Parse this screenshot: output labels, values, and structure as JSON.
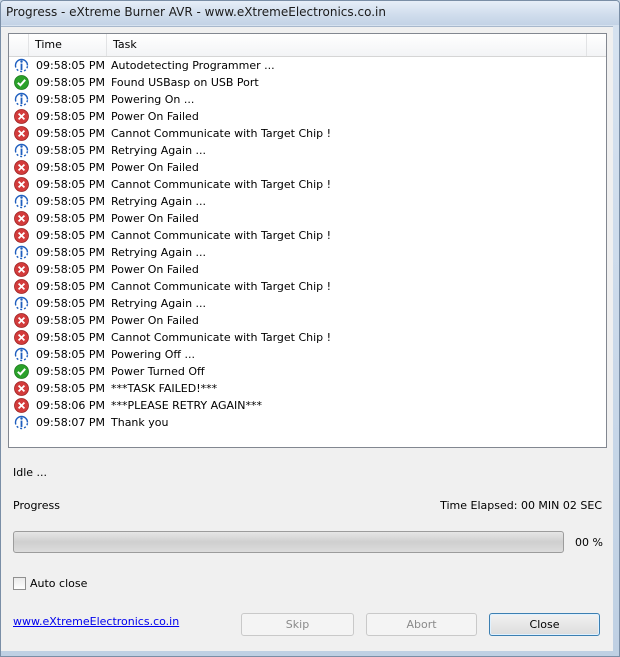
{
  "window": {
    "title": "Progress - eXtreme Burner AVR - www.eXtremeElectronics.co.in"
  },
  "colors": {
    "info": "#1f5fbf",
    "success": "#2aa12a",
    "error": "#d33b3b",
    "progress_fill": "#06b025"
  },
  "log": {
    "columns": {
      "time": "Time",
      "task": "Task"
    },
    "rows": [
      {
        "icon": "info-icon",
        "time": "09:58:05 PM",
        "task": "Autodetecting Programmer ..."
      },
      {
        "icon": "success-icon",
        "time": "09:58:05 PM",
        "task": "Found USBasp on USB Port"
      },
      {
        "icon": "info-icon",
        "time": "09:58:05 PM",
        "task": "Powering On ..."
      },
      {
        "icon": "error-icon",
        "time": "09:58:05 PM",
        "task": "Power On Failed"
      },
      {
        "icon": "error-icon",
        "time": "09:58:05 PM",
        "task": "Cannot Communicate with Target Chip !"
      },
      {
        "icon": "info-icon",
        "time": "09:58:05 PM",
        "task": "Retrying Again ..."
      },
      {
        "icon": "error-icon",
        "time": "09:58:05 PM",
        "task": "Power On Failed"
      },
      {
        "icon": "error-icon",
        "time": "09:58:05 PM",
        "task": "Cannot Communicate with Target Chip !"
      },
      {
        "icon": "info-icon",
        "time": "09:58:05 PM",
        "task": "Retrying Again ..."
      },
      {
        "icon": "error-icon",
        "time": "09:58:05 PM",
        "task": "Power On Failed"
      },
      {
        "icon": "error-icon",
        "time": "09:58:05 PM",
        "task": "Cannot Communicate with Target Chip !"
      },
      {
        "icon": "info-icon",
        "time": "09:58:05 PM",
        "task": "Retrying Again ..."
      },
      {
        "icon": "error-icon",
        "time": "09:58:05 PM",
        "task": "Power On Failed"
      },
      {
        "icon": "error-icon",
        "time": "09:58:05 PM",
        "task": "Cannot Communicate with Target Chip !"
      },
      {
        "icon": "info-icon",
        "time": "09:58:05 PM",
        "task": "Retrying Again ..."
      },
      {
        "icon": "error-icon",
        "time": "09:58:05 PM",
        "task": "Power On Failed"
      },
      {
        "icon": "error-icon",
        "time": "09:58:05 PM",
        "task": "Cannot Communicate with Target Chip !"
      },
      {
        "icon": "info-icon",
        "time": "09:58:05 PM",
        "task": "Powering Off ..."
      },
      {
        "icon": "success-icon",
        "time": "09:58:05 PM",
        "task": "Power Turned Off"
      },
      {
        "icon": "error-icon",
        "time": "09:58:05 PM",
        "task": "***TASK FAILED!***"
      },
      {
        "icon": "error-icon",
        "time": "09:58:06 PM",
        "task": "***PLEASE RETRY AGAIN***"
      },
      {
        "icon": "info-icon",
        "time": "09:58:07 PM",
        "task": "Thank you"
      }
    ]
  },
  "status": {
    "state": "Idle ..."
  },
  "progress": {
    "label": "Progress",
    "elapsed": "Time Elapsed: 00 MIN  02 SEC",
    "percent_text": "00 %",
    "fraction": 0.0
  },
  "options": {
    "auto_close_label": "Auto close",
    "auto_close_checked": false
  },
  "footer": {
    "link": "www.eXtremeElectronics.co.in",
    "skip": "Skip",
    "abort": "Abort",
    "close": "Close"
  }
}
